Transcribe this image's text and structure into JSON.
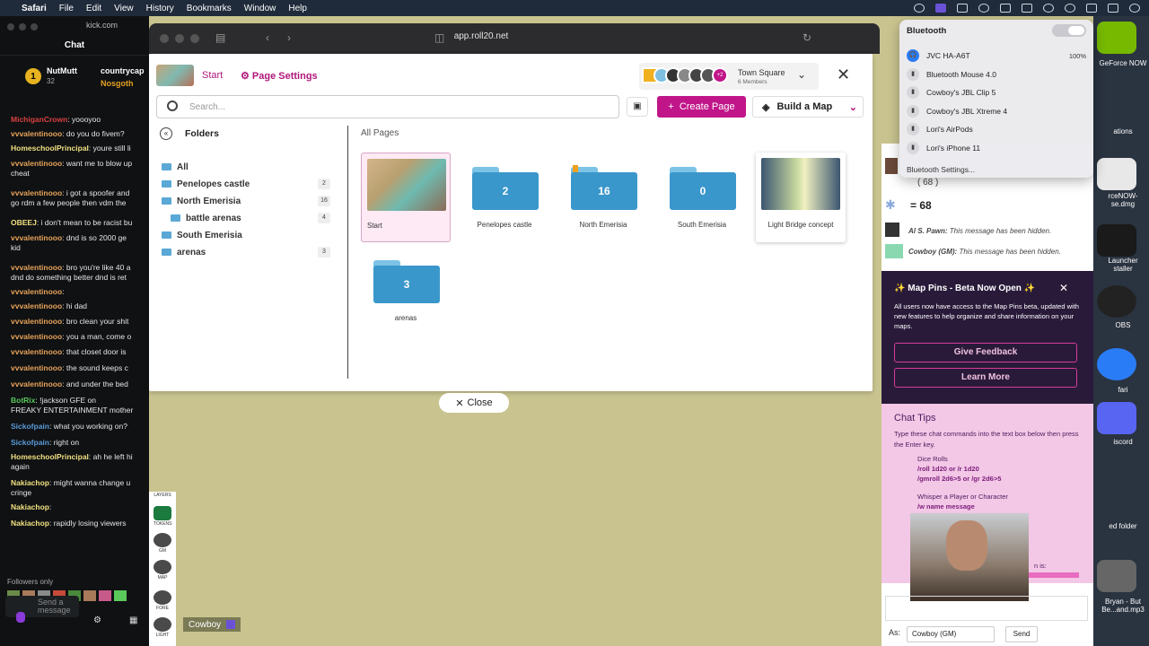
{
  "menubar": {
    "apple": "",
    "app": "Safari",
    "items": [
      "File",
      "Edit",
      "View",
      "History",
      "Bookmarks",
      "Window",
      "Help"
    ]
  },
  "kick": {
    "url": "kick.com",
    "chat_title": "Chat",
    "leader1": "NutMutt",
    "leader1_count": "32",
    "leader2": "countrycap",
    "leader3": "Nosgoth",
    "badge": "1",
    "messages": [
      {
        "user": "MichiganCrown",
        "text": ": yoooyoo",
        "color": "#d84040"
      },
      {
        "user": "vvvalentinooo",
        "text": ": do you do fivem?",
        "color": "#e8a35a"
      },
      {
        "user": "HomeschoolPrincipal",
        "text": ": youre still li",
        "color": "#f0e080"
      },
      {
        "user": "vvvalentinooo",
        "text": ": want me to blow up",
        "color": "#e8a35a"
      },
      {
        "user": "",
        "text": "cheat",
        "color": "#e5e5e5"
      },
      {
        "user": "vvvalentinooo",
        "text": ": i got a spoofer and",
        "color": "#e8a35a"
      },
      {
        "user": "",
        "text": "go rdm a few people then vdm the",
        "color": "#e5e5e5"
      },
      {
        "user": "OBEEJ",
        "text": ": i don't mean to be racist bu",
        "color": "#f0e080"
      },
      {
        "user": "vvvalentinooo",
        "text": ": dnd is so 2000 ge",
        "color": "#e8a35a"
      },
      {
        "user": "",
        "text": "kid",
        "color": "#e5e5e5"
      },
      {
        "user": "vvvalentinooo",
        "text": ": bro you're like 40 a",
        "color": "#e8a35a"
      },
      {
        "user": "",
        "text": "dnd do something better dnd is ret",
        "color": "#e5e5e5"
      },
      {
        "user": "vvvalentinooo",
        "text": ":",
        "color": "#e8a35a"
      },
      {
        "user": "vvvalentinooo",
        "text": ": hi dad",
        "color": "#e8a35a"
      },
      {
        "user": "vvvalentinooo",
        "text": ": bro clean your shit",
        "color": "#e8a35a"
      },
      {
        "user": "vvvalentinooo",
        "text": ": you a man, come o",
        "color": "#e8a35a"
      },
      {
        "user": "vvvalentinooo",
        "text": ": that closet door is",
        "color": "#e8a35a"
      },
      {
        "user": "vvvalentinooo",
        "text": ": the sound keeps c",
        "color": "#e8a35a"
      },
      {
        "user": "vvvalentinooo",
        "text": ": and under the bed",
        "color": "#e8a35a"
      },
      {
        "user": "BotRix",
        "text": ": !jackson GFE on",
        "color": "#5ac85a"
      },
      {
        "user": "",
        "text": "FREAKY ENTERTAINMENT mother",
        "color": "#e5e5e5"
      },
      {
        "user": "Sickofpain",
        "text": ": what you working on?",
        "color": "#5a9ad8"
      },
      {
        "user": "Sickofpain",
        "text": ": right on",
        "color": "#5a9ad8"
      },
      {
        "user": "HomeschoolPrincipal",
        "text": ": ah he left hi",
        "color": "#f0e080"
      },
      {
        "user": "",
        "text": "again",
        "color": "#e5e5e5"
      },
      {
        "user": "Nakiachop",
        "text": ": might wanna change u",
        "color": "#f0e080"
      },
      {
        "user": "",
        "text": "cringe",
        "color": "#e5e5e5"
      },
      {
        "user": "Nakiachop",
        "text": ":",
        "color": "#f0e080"
      },
      {
        "user": "Nakiachop",
        "text": ": rapidly losing viewers",
        "color": "#f0e080"
      }
    ],
    "followers_only": "Followers only",
    "send_placeholder": "Send a message"
  },
  "safari": {
    "url": "app.roll20.net"
  },
  "dialog": {
    "start": "Start",
    "page_settings": "Page Settings",
    "campaign_name": "Town Square",
    "campaign_members": "6 Members",
    "avatar_more": "+2",
    "search_placeholder": "Search...",
    "create_page": "Create Page",
    "build_map": "Build a Map",
    "folders_title": "Folders",
    "all_pages_title": "All Pages",
    "tree": [
      {
        "label": "All",
        "count": ""
      },
      {
        "label": "Penelopes castle",
        "count": "2"
      },
      {
        "label": "North Emerisia",
        "count": "16"
      },
      {
        "label": "battle arenas",
        "count": "4"
      },
      {
        "label": "South Emerisia",
        "count": ""
      },
      {
        "label": "arenas",
        "count": "3"
      }
    ],
    "cards": [
      {
        "label": "Start",
        "type": "page"
      },
      {
        "label": "Penelopes castle",
        "type": "folder",
        "count": "2"
      },
      {
        "label": "North Emerisia",
        "type": "folder",
        "count": "16"
      },
      {
        "label": "South Emerisia",
        "type": "folder",
        "count": "0"
      },
      {
        "label": "Light Bridge concept",
        "type": "page"
      },
      {
        "label": "arenas",
        "type": "folder",
        "count": "3"
      }
    ],
    "close": "Close"
  },
  "vtt": {
    "tools": [
      "LAYERS",
      "TOKENS",
      "GM",
      "MAP",
      "FORE",
      "LIGHT"
    ],
    "player_tag": "Cowboy"
  },
  "chat": {
    "roll_top": "( 68 )",
    "roll_value": "= 68",
    "hidden1_name": "Al S. Pawn:",
    "hidden1_text": "This message has been hidden.",
    "hidden2_name": "Cowboy (GM):",
    "hidden2_text": "This message has been hidden.",
    "mappins_title": "Map Pins - Beta Now Open",
    "mappins_desc": "All users now have access to the Map Pins beta, updated with new features to help organize and share information on your maps.",
    "give_feedback": "Give Feedback",
    "learn_more": "Learn More",
    "tips_title": "Chat Tips",
    "tips_desc": "Type these chat commands into the text box below then press the Enter key.",
    "tip1_title": "Dice Rolls",
    "tip1_cmd": "/roll 1d20 or /r 1d20",
    "tip1_cmd2": "/gmroll 2d6>5 or /gr 2d6>5",
    "tip2_title": "Whisper a Player or Character",
    "tip2_cmd": "/w name message",
    "partial": "n is:",
    "as_label": "As:",
    "as_value": "Cowboy (GM)",
    "send": "Send"
  },
  "bluetooth": {
    "title": "Bluetooth",
    "devices": [
      {
        "name": "JVC HA-A6T",
        "battery": "100%",
        "on": true
      },
      {
        "name": "Bluetooth Mouse 4.0",
        "battery": "",
        "on": false
      },
      {
        "name": "Cowboy's JBL Clip 5",
        "battery": "",
        "on": false
      },
      {
        "name": "Cowboy's JBL Xtreme 4",
        "battery": "",
        "on": false
      },
      {
        "name": "Lori's AirPods",
        "battery": "",
        "on": false
      },
      {
        "name": "Lori's iPhone 11",
        "battery": "",
        "on": false
      }
    ],
    "settings": "Bluetooth Settings..."
  },
  "desktop": {
    "labels": [
      "GeForce NOW",
      "ations",
      "rceNOW-\nse.dmg",
      "Launcher\nstaller",
      "OBS",
      "fari",
      "iscord",
      "ed folder",
      "Bryan - But\nBe...and.mp3"
    ]
  }
}
